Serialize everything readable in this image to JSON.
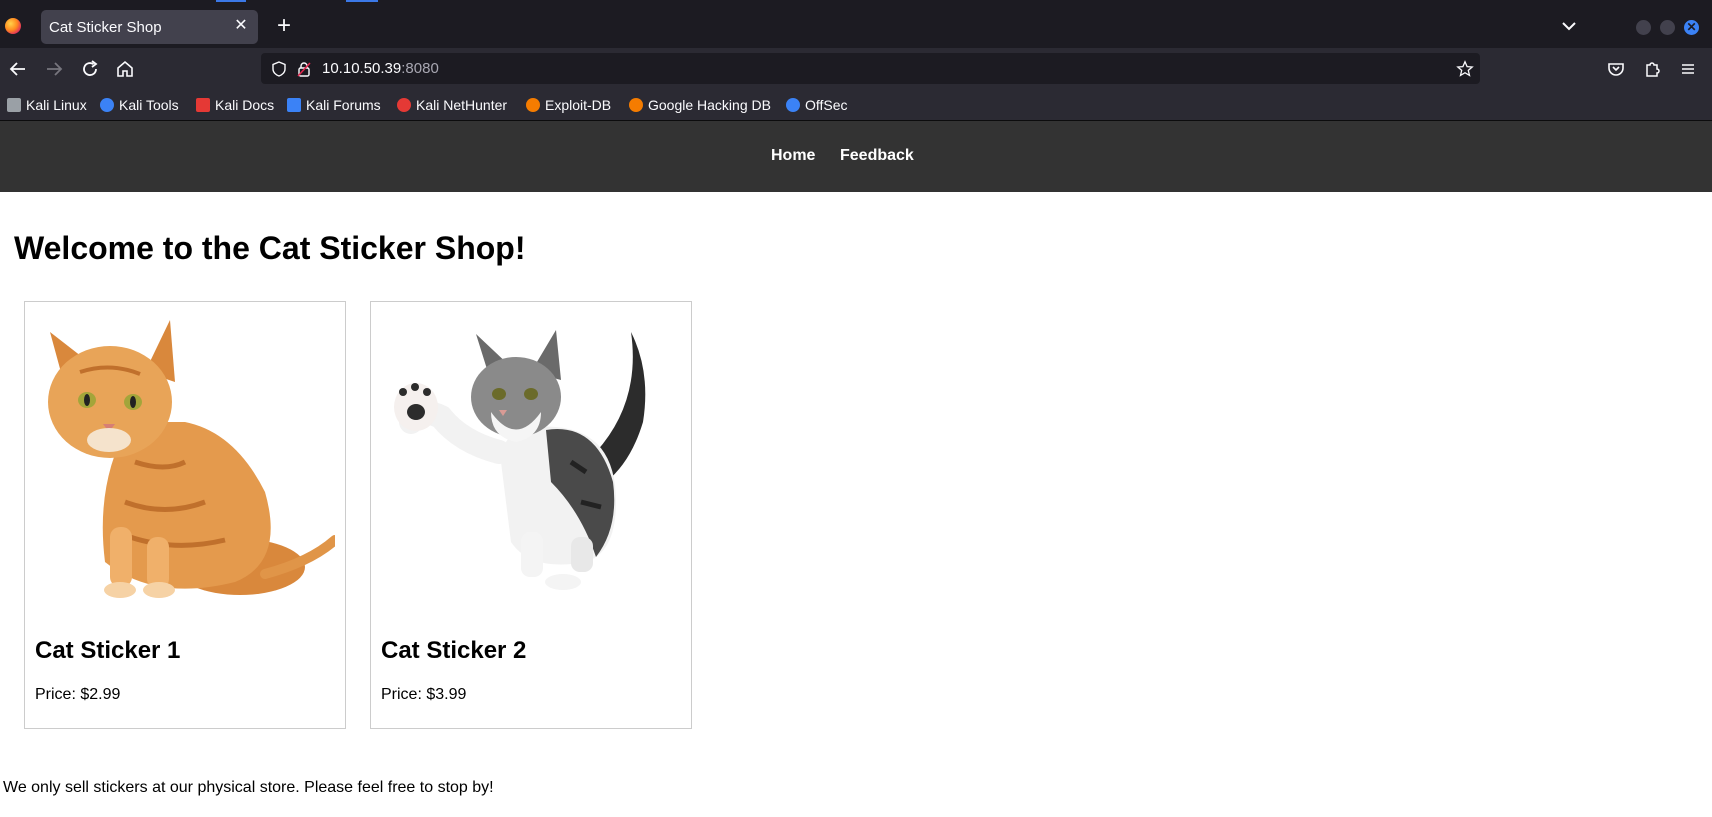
{
  "browser": {
    "tab_title": "Cat Sticker Shop",
    "url_host": "10.10.50.39",
    "url_port": ":8080",
    "bookmarks": [
      {
        "label": "Kali Linux",
        "icon": "kali-dragon-icon",
        "color": "#9aa0a6"
      },
      {
        "label": "Kali Tools",
        "icon": "kali-tools-icon",
        "color": "#3b82f6"
      },
      {
        "label": "Kali Docs",
        "icon": "kali-docs-icon",
        "color": "#e53935"
      },
      {
        "label": "Kali Forums",
        "icon": "kali-forums-icon",
        "color": "#3b82f6"
      },
      {
        "label": "Kali NetHunter",
        "icon": "kali-nethunter-icon",
        "color": "#e53935"
      },
      {
        "label": "Exploit-DB",
        "icon": "exploit-db-icon",
        "color": "#f57c00"
      },
      {
        "label": "Google Hacking DB",
        "icon": "ghdb-icon",
        "color": "#f57c00"
      },
      {
        "label": "OffSec",
        "icon": "offsec-icon",
        "color": "#3b82f6"
      }
    ]
  },
  "site": {
    "nav": {
      "home": "Home",
      "feedback": "Feedback"
    },
    "heading": "Welcome to the Cat Sticker Shop!",
    "products": [
      {
        "name": "Cat Sticker 1",
        "price": "Price: $2.99",
        "image": "orange-tabby-cat-sitting"
      },
      {
        "name": "Cat Sticker 2",
        "price": "Price: $3.99",
        "image": "white-gray-kitten-raising-paw"
      }
    ],
    "footer": "We only sell stickers at our physical store. Please feel free to stop by!"
  },
  "colors": {
    "chrome_dark": "#1c1b22",
    "chrome": "#2b2a33",
    "site_nav": "#333333",
    "accent": "#3b82f6"
  }
}
